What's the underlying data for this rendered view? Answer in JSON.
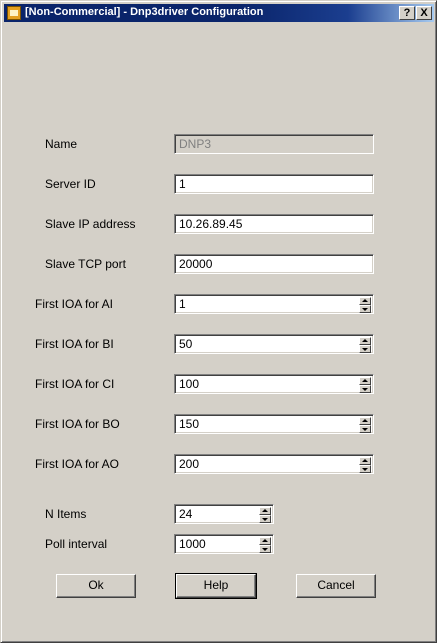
{
  "window": {
    "title": "[Non-Commercial] - Dnp3driver Configuration",
    "help_button": "?",
    "close_button": "X"
  },
  "fields": {
    "name": {
      "label": "Name",
      "value": "DNP3"
    },
    "server_id": {
      "label": "Server ID",
      "value": "1"
    },
    "slave_ip": {
      "label": "Slave IP address",
      "value": "10.26.89.45"
    },
    "slave_port": {
      "label": "Slave TCP port",
      "value": "20000"
    },
    "ioa_ai": {
      "label": "First IOA for AI",
      "value": "1"
    },
    "ioa_bi": {
      "label": "First IOA for BI",
      "value": "50"
    },
    "ioa_ci": {
      "label": "First IOA for CI",
      "value": "100"
    },
    "ioa_bo": {
      "label": "First IOA for BO",
      "value": "150"
    },
    "ioa_ao": {
      "label": "First IOA for AO",
      "value": "200"
    },
    "n_items": {
      "label": "N Items",
      "value": "24"
    },
    "poll_interval": {
      "label": "Poll interval",
      "value": "1000"
    }
  },
  "buttons": {
    "ok": "Ok",
    "help": "Help",
    "cancel": "Cancel"
  }
}
